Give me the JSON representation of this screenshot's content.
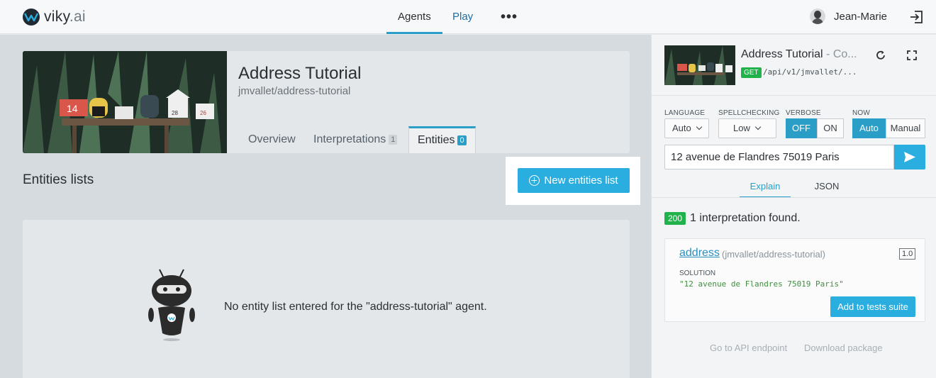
{
  "topnav": {
    "logo_main": "viky",
    "logo_suffix": ".ai",
    "items": [
      "Agents",
      "Play"
    ],
    "more": "•••",
    "user_name": "Jean-Marie"
  },
  "agent": {
    "title": "Address Tutorial",
    "slug": "jmvallet/address-tutorial",
    "tabs": [
      {
        "label": "Overview"
      },
      {
        "label": "Interpretations",
        "count": "1"
      },
      {
        "label": "Entities",
        "count": "0"
      }
    ]
  },
  "entities": {
    "section_title": "Entities lists",
    "new_button": "New entities list",
    "empty_message": "No entity list entered for the \"address-tutorial\" agent."
  },
  "panel": {
    "title": "Address Tutorial",
    "title_suffix": " - Co...",
    "method": "GET",
    "url": "/api/v1/jmvallet/...",
    "options": {
      "language_label": "LANGUAGE",
      "language_value": "Auto",
      "spellchecking_label": "SPELLCHECKING",
      "spellchecking_value": "Low",
      "verbose_label": "VERBOSE",
      "verbose_off": "OFF",
      "verbose_on": "ON",
      "now_label": "NOW",
      "now_auto": "Auto",
      "now_manual": "Manual"
    },
    "query": "12 avenue de Flandres 75019 Paris",
    "tabs": [
      "Explain",
      "JSON"
    ],
    "status_code": "200",
    "found_text": "1 interpretation found.",
    "result": {
      "name": "address",
      "slug": "(jmvallet/address-tutorial)",
      "score": "1.0",
      "solution_label": "SOLUTION",
      "solution_value": "\"12 avenue de Flandres 75019 Paris\"",
      "add_button": "Add to tests suite"
    },
    "footer_links": [
      "Go to API endpoint",
      "Download package"
    ]
  },
  "colors": {
    "accent": "#2aaee0",
    "tab_accent": "#2a9ec6",
    "success": "#22b24c"
  }
}
